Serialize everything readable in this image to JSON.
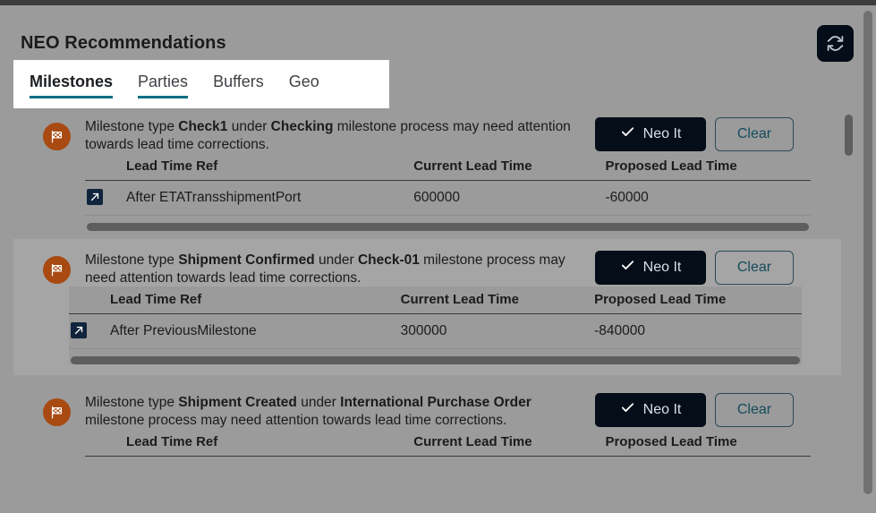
{
  "header": {
    "title": "NEO Recommendations",
    "refresh_icon": "refresh-sync-icon"
  },
  "tabs": [
    {
      "label": "Milestones",
      "active": true,
      "underlined": true
    },
    {
      "label": "Parties",
      "active": false,
      "underlined": true
    },
    {
      "label": "Buffers",
      "active": false,
      "underlined": false
    },
    {
      "label": "Geo",
      "active": false,
      "underlined": false
    }
  ],
  "colors": {
    "accent_teal": "#0b6e84",
    "button_dark": "#040d18",
    "flag_orange": "#a84a12",
    "row_icon_navy": "#10243c",
    "panel_bg": "#9b9b9b",
    "card_highlight_bg": "#a5a5a5",
    "scrollbar_thumb": "#5e5e5e"
  },
  "table_headers": {
    "icon": "",
    "lead_time_ref": "Lead Time Ref",
    "current_lead_time": "Current Lead Time",
    "proposed_lead_time": "Proposed Lead Time"
  },
  "buttons": {
    "neo_it": "Neo It",
    "clear": "Clear",
    "neo_it_icon": "check-icon"
  },
  "cards": [
    {
      "icon": "checkered-flag-icon",
      "text_prefix": "Milestone type ",
      "milestone_type": "Check1",
      "text_mid": " under ",
      "process_name": "Checking",
      "text_suffix": " milestone process may need attention towards lead time corrections.",
      "highlighted": false,
      "rows": [
        {
          "row_icon": "open-arrow-icon",
          "lead_time_ref": "After ETATransshipmentPort",
          "current_lead_time": "600000",
          "proposed_lead_time": "-60000"
        }
      ]
    },
    {
      "icon": "checkered-flag-icon",
      "text_prefix": "Milestone type ",
      "milestone_type": "Shipment Confirmed",
      "text_mid": " under ",
      "process_name": "Check-01",
      "text_suffix": " milestone process may need attention towards lead time corrections.",
      "highlighted": true,
      "rows": [
        {
          "row_icon": "open-arrow-icon",
          "lead_time_ref": "After PreviousMilestone",
          "current_lead_time": "300000",
          "proposed_lead_time": "-840000"
        }
      ]
    },
    {
      "icon": "checkered-flag-icon",
      "text_prefix": "Milestone type ",
      "milestone_type": "Shipment Created",
      "text_mid": " under ",
      "process_name": "International Purchase Order",
      "text_suffix": " milestone process may need attention towards lead time corrections.",
      "highlighted": false,
      "rows": []
    }
  ]
}
